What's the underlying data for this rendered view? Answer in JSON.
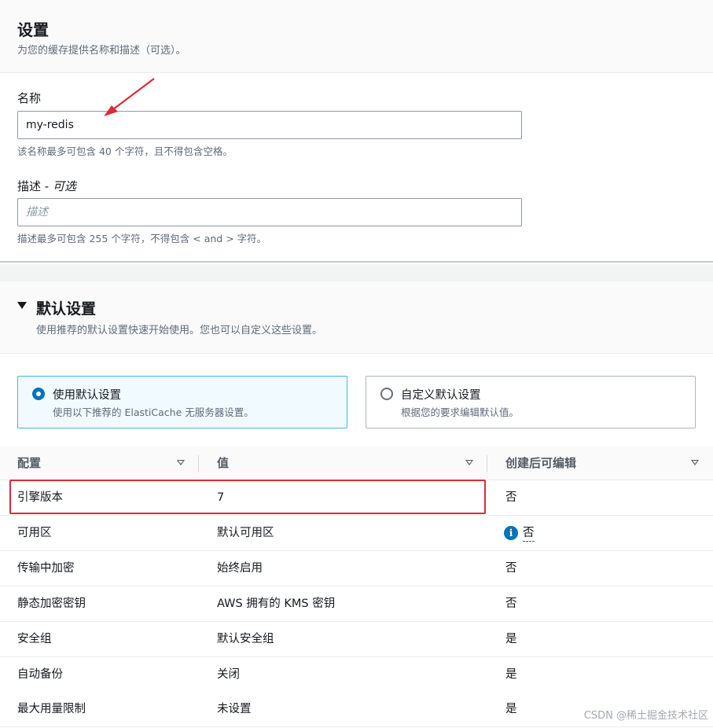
{
  "settings": {
    "title": "设置",
    "description": "为您的缓存提供名称和描述（可选）。",
    "name_label": "名称",
    "name_value": "my-redis",
    "name_hint": "该名称最多可包含 40 个字符，且不得包含空格。",
    "desc_label_main": "描述 - ",
    "desc_label_optional": "可选",
    "desc_placeholder": "描述",
    "desc_hint": "描述最多可包含 255 个字符，不得包含 < and > 字符。"
  },
  "defaults": {
    "title": "默认设置",
    "description": "使用推荐的默认设置快速开始使用。您也可以自定义这些设置。",
    "options": [
      {
        "label": "使用默认设置",
        "desc": "使用以下推荐的 ElastiCache 无服务器设置。",
        "selected": true
      },
      {
        "label": "自定义默认设置",
        "desc": "根据您的要求编辑默认值。",
        "selected": false
      }
    ]
  },
  "table": {
    "headers": [
      "配置",
      "值",
      "创建后可编辑"
    ],
    "rows": [
      {
        "config": "引擎版本",
        "value": "7",
        "editable": "否"
      },
      {
        "config": "可用区",
        "value": "默认可用区",
        "editable": "否",
        "info": true
      },
      {
        "config": "传输中加密",
        "value": "始终启用",
        "editable": "否"
      },
      {
        "config": "静态加密密钥",
        "value": "AWS 拥有的 KMS 密钥",
        "editable": "否"
      },
      {
        "config": "安全组",
        "value": "默认安全组",
        "editable": "是"
      },
      {
        "config": "自动备份",
        "value": "关闭",
        "editable": "是"
      },
      {
        "config": "最大用量限制",
        "value": "未设置",
        "editable": "是"
      }
    ]
  },
  "watermark": "CSDN @稀土掘金技术社区",
  "colors": {
    "accent": "#0073bb",
    "annotation": "#d92b3a",
    "tile_selected_border": "#44b9d6"
  },
  "icons": {
    "info": "info-icon",
    "collapse": "caret-down-icon",
    "sort": "sort-icon",
    "radio": "radio-icon"
  }
}
